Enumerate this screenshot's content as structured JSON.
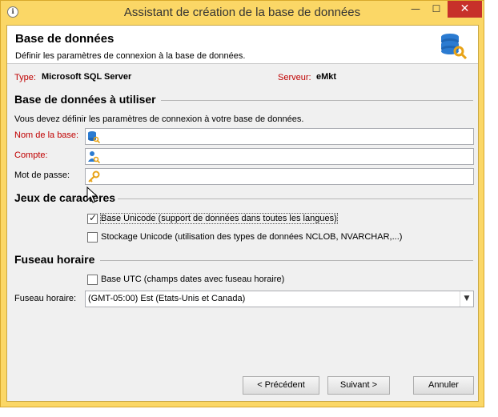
{
  "window": {
    "title": "Assistant de création de la base de données",
    "app_icon": "ℹ",
    "minimize_glyph": "—",
    "maximize_glyph": "☐",
    "close_glyph": "✕"
  },
  "header": {
    "title": "Base de données",
    "subtitle": "Définir les paramètres de connexion à la base de données.",
    "icon": "database-key-icon"
  },
  "info": {
    "type_label": "Type:",
    "type_value": "Microsoft SQL Server",
    "server_label": "Serveur:",
    "server_value": "eMkt"
  },
  "database_section": {
    "title": "Base de données à utiliser",
    "description": "Vous devez définir les paramètres de connexion à votre base de données.",
    "fields": [
      {
        "label": "Nom de la base:",
        "value": "",
        "required": true,
        "icon": "database-key-icon"
      },
      {
        "label": "Compte:",
        "value": "",
        "required": true,
        "icon": "user-key-icon"
      },
      {
        "label": "Mot de passe:",
        "value": "",
        "required": false,
        "icon": "key-icon"
      }
    ]
  },
  "charset_section": {
    "title": "Jeux de caractères",
    "unicode_base": {
      "label": "Base Unicode (support de données dans toutes les langues)",
      "checked": true
    },
    "unicode_storage": {
      "label": "Stockage Unicode (utilisation des types de données NCLOB, NVARCHAR,...)",
      "checked": false
    }
  },
  "timezone_section": {
    "title": "Fuseau horaire",
    "utc_base": {
      "label": "Base UTC (champs dates avec fuseau horaire)",
      "checked": false
    },
    "timezone_label": "Fuseau horaire:",
    "timezone_value": "(GMT-05:00) Est (Etats-Unis et Canada)"
  },
  "footer": {
    "previous_label": "< Précédent",
    "next_label": "Suivant >",
    "cancel_label": "Annuler"
  },
  "colors": {
    "title_bar": "#fbd766",
    "close_button": "#c7302a",
    "required_label": "#c00000"
  }
}
